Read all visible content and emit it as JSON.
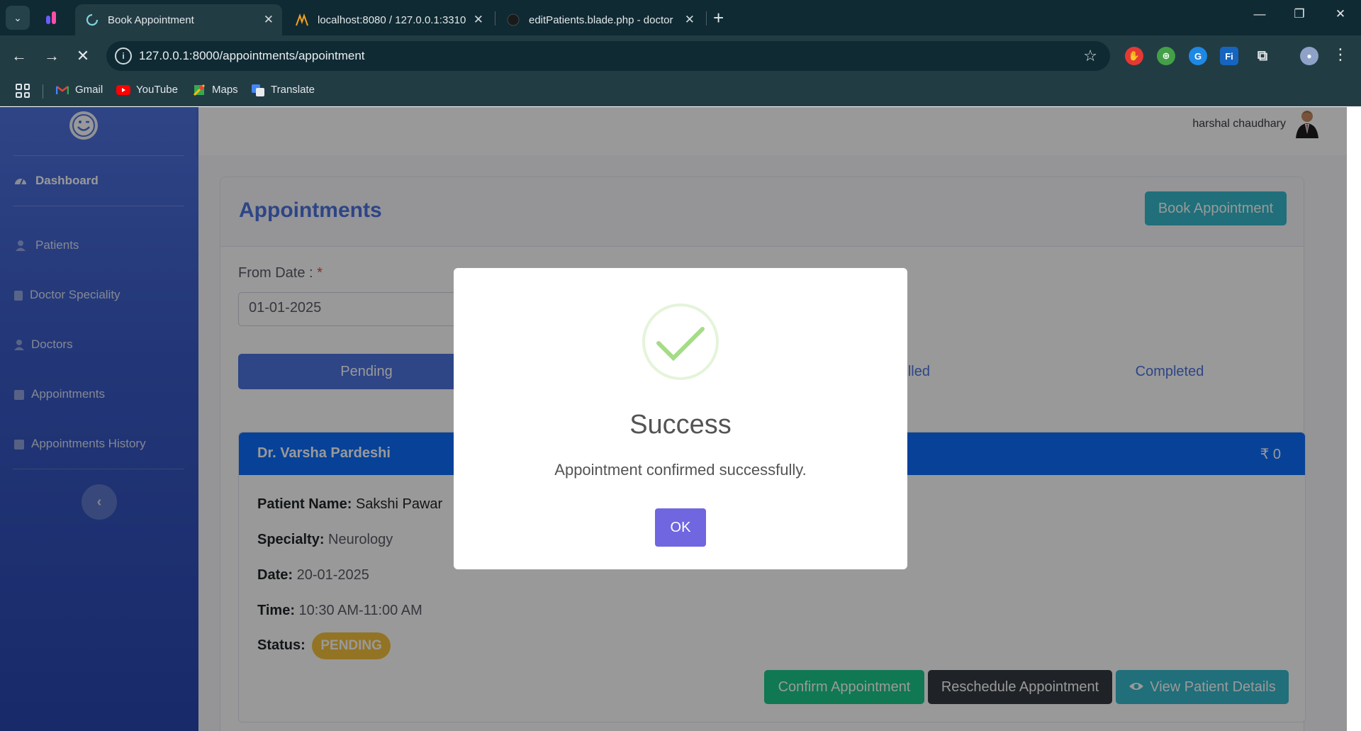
{
  "browser": {
    "tabs": [
      {
        "title": "Book Appointment",
        "icon": "loading-spinner-icon",
        "active": true
      },
      {
        "title": "localhost:8080 / 127.0.0.1:3310",
        "icon": "phpmyadmin-icon",
        "active": false
      },
      {
        "title": "editPatients.blade.php - doctor",
        "icon": "github-icon",
        "active": false
      }
    ],
    "url": "127.0.0.1:8000/appointments/appointment",
    "bookmarks": [
      {
        "label": "Gmail",
        "icon": "gmail-icon"
      },
      {
        "label": "YouTube",
        "icon": "youtube-icon"
      },
      {
        "label": "Maps",
        "icon": "maps-icon"
      },
      {
        "label": "Translate",
        "icon": "translate-icon"
      }
    ]
  },
  "sidebar": {
    "items": [
      {
        "label": "Dashboard",
        "icon": "tachometer-icon"
      },
      {
        "label": "Patients",
        "icon": "user-icon"
      },
      {
        "label": "Doctor Speciality",
        "icon": "clipboard-icon"
      },
      {
        "label": "Doctors",
        "icon": "user-icon"
      },
      {
        "label": "Appointments",
        "icon": "calendar-icon"
      },
      {
        "label": "Appointments History",
        "icon": "calendar-icon"
      }
    ],
    "toggle": "‹"
  },
  "topbar": {
    "user_name": "harshal chaudhary"
  },
  "page": {
    "title": "Appointments",
    "book_button": "Book Appointment",
    "from_date_label": "From Date :",
    "required_mark": "*",
    "from_date_value": "01-01-2025",
    "tabs": [
      "Pending",
      "lled",
      "Completed"
    ]
  },
  "appointment": {
    "doctor": "Dr. Varsha Pardeshi",
    "fee": "₹ 0",
    "patient_label": "Patient Name:",
    "patient_value": "Sakshi Pawar",
    "specialty_label": "Specialty:",
    "specialty_value": "Neurology",
    "date_label": "Date:",
    "date_value": "20-01-2025",
    "time_label": "Time:",
    "time_value": "10:30 AM-11:00 AM",
    "status_label": "Status:",
    "status_value": "PENDING",
    "actions": [
      "Confirm Appointment",
      "Reschedule Appointment",
      "View Patient Details"
    ]
  },
  "modal": {
    "title": "Success",
    "message": "Appointment confirmed successfully.",
    "ok": "OK"
  },
  "colors": {
    "primary": "#4e73df",
    "info": "#36b9cc",
    "success": "#1cc88a",
    "dark": "#343a40",
    "warning": "#f6c23e",
    "header_blue": "#0d6efd",
    "swal_confirm": "#7066e0",
    "swal_success": "#a5dc86"
  }
}
